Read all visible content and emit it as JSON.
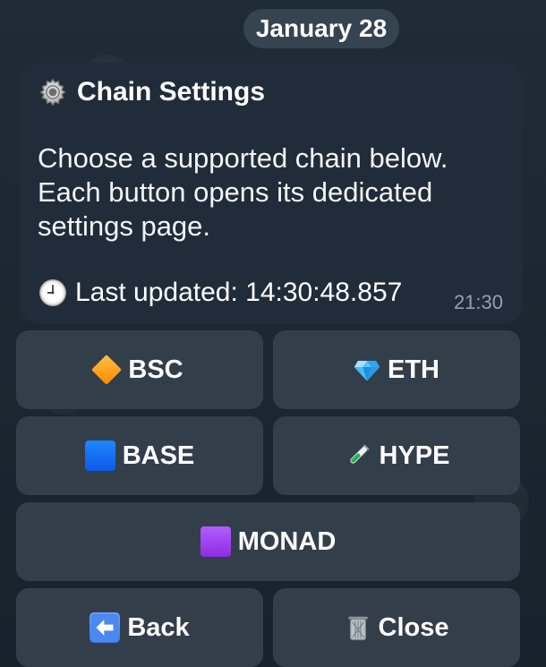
{
  "date_badge": {
    "label": "January 28"
  },
  "message": {
    "title": "Chain Settings",
    "body": "Choose a supported chain below. Each button opens its dedicated settings page.",
    "status_label": "Last updated: 14:30:48.857",
    "time": "21:30",
    "icons": {
      "title": "gear-icon",
      "status": "clock-icon"
    }
  },
  "keyboard": {
    "buttons": [
      {
        "label": "BSC",
        "icon": "orange-diamond-icon"
      },
      {
        "label": "ETH",
        "icon": "gem-icon"
      },
      {
        "label": "BASE",
        "icon": "blue-square-icon"
      },
      {
        "label": "HYPE",
        "icon": "test-tube-icon"
      },
      {
        "label": "MONAD",
        "icon": "purple-square-icon"
      },
      {
        "label": "Back",
        "icon": "back-arrow-icon"
      },
      {
        "label": "Close",
        "icon": "trash-can-icon"
      }
    ]
  },
  "colors": {
    "background": "#1b2531",
    "bubble": "#202c39",
    "button": "#34404c",
    "muted_text": "#93a0ae",
    "bsc_icon": "#ff9b12",
    "eth_icon": "#67c8ff",
    "base_icon": "#1577ff",
    "hype_icon": "#28b44c",
    "monad_icon": "#9c43f2",
    "back_icon": "#4d87f0"
  }
}
